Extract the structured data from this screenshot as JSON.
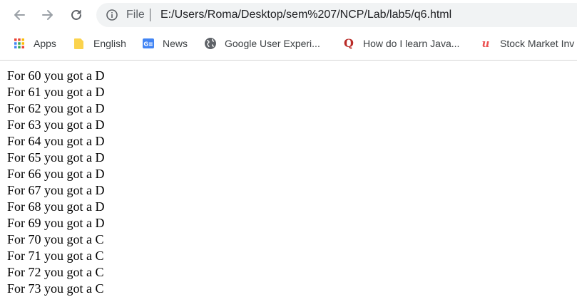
{
  "browser": {
    "file_label": "File",
    "url": "E:/Users/Roma/Desktop/sem%207/NCP/Lab/lab5/q6.html",
    "bookmarks": [
      {
        "label": "Apps",
        "icon": "apps-grid-icon"
      },
      {
        "label": "English",
        "icon": "folder-icon"
      },
      {
        "label": "News",
        "icon": "google-news-icon"
      },
      {
        "label": "Google User Experi...",
        "icon": "globe-icon"
      },
      {
        "label": "How do I learn Java...",
        "icon": "quora-icon"
      },
      {
        "label": "Stock Market Inv",
        "icon": "udemy-icon"
      }
    ]
  },
  "page": {
    "lines": [
      "For 60 you got a D",
      "For 61 you got a D",
      "For 62 you got a D",
      "For 63 you got a D",
      "For 64 you got a D",
      "For 65 you got a D",
      "For 66 you got a D",
      "For 67 you got a D",
      "For 68 you got a D",
      "For 69 you got a D",
      "For 70 you got a C",
      "For 71 you got a C",
      "For 72 you got a C",
      "For 73 you got a C"
    ]
  }
}
